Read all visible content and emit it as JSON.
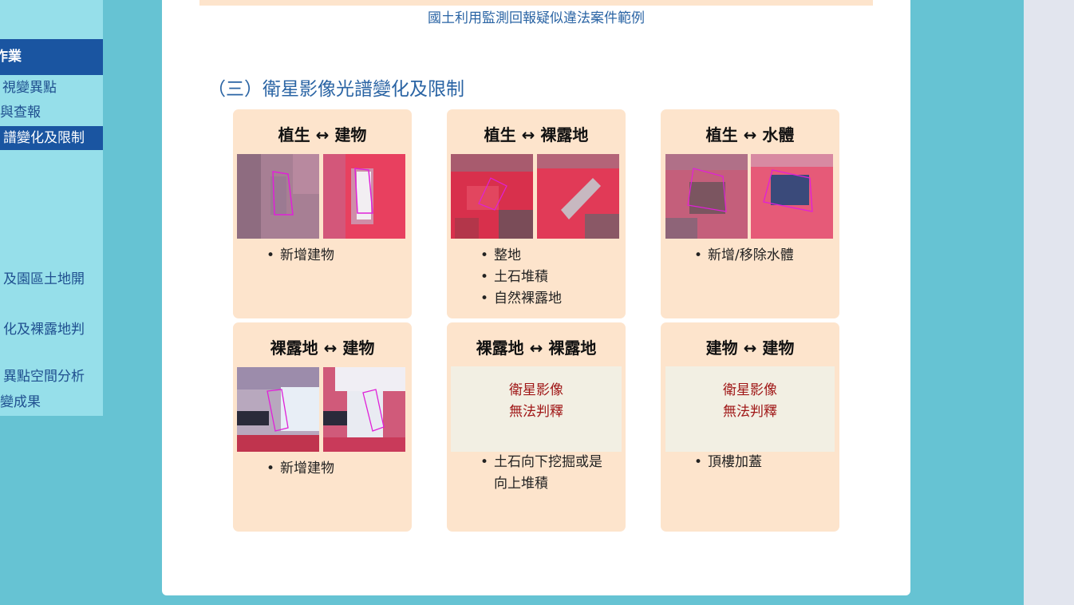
{
  "sidebar": {
    "items": [
      {
        "label": "作業",
        "type": "header"
      },
      {
        "label": "視變異點",
        "type": "normal"
      },
      {
        "label": "與查報",
        "type": "normal"
      },
      {
        "label": "譜變化及限制",
        "type": "active"
      },
      {
        "label": "及園區土地開",
        "type": "normal"
      },
      {
        "label": "化及裸露地判",
        "type": "normal"
      },
      {
        "label": "異點空間分析",
        "type": "normal"
      },
      {
        "label": "變成果",
        "type": "normal"
      }
    ]
  },
  "main": {
    "caption": "國土利用監測回報疑似違法案件範例",
    "section_title": "（三）衛星影像光譜變化及限制",
    "cards": [
      {
        "title": "植生 ↔ 建物",
        "bullets": [
          "新增建物"
        ]
      },
      {
        "title": "植生 ↔ 裸露地",
        "bullets": [
          "整地",
          "土石堆積",
          "自然裸露地"
        ]
      },
      {
        "title": "植生 ↔ 水體",
        "bullets": [
          "新增/移除水體"
        ]
      },
      {
        "title": "裸露地 ↔ 建物",
        "bullets": [
          "新增建物"
        ]
      },
      {
        "title": "裸露地 ↔ 裸露地",
        "notice": [
          "衛星影像",
          "無法判釋"
        ],
        "bullets": [
          "土石向下挖掘或是",
          "向上堆積"
        ]
      },
      {
        "title": "建物 ↔ 建物",
        "notice": [
          "衛星影像",
          "無法判釋"
        ],
        "bullets": [
          "頂樓加蓋"
        ]
      }
    ]
  },
  "colors": {
    "page_bg": "#66c3d3",
    "sidebar_bg": "#96dfea",
    "sidebar_active": "#1a55a1",
    "card_bg": "#fde4cc",
    "heading_blue": "#2a64a4",
    "notice_red": "#a01818"
  }
}
